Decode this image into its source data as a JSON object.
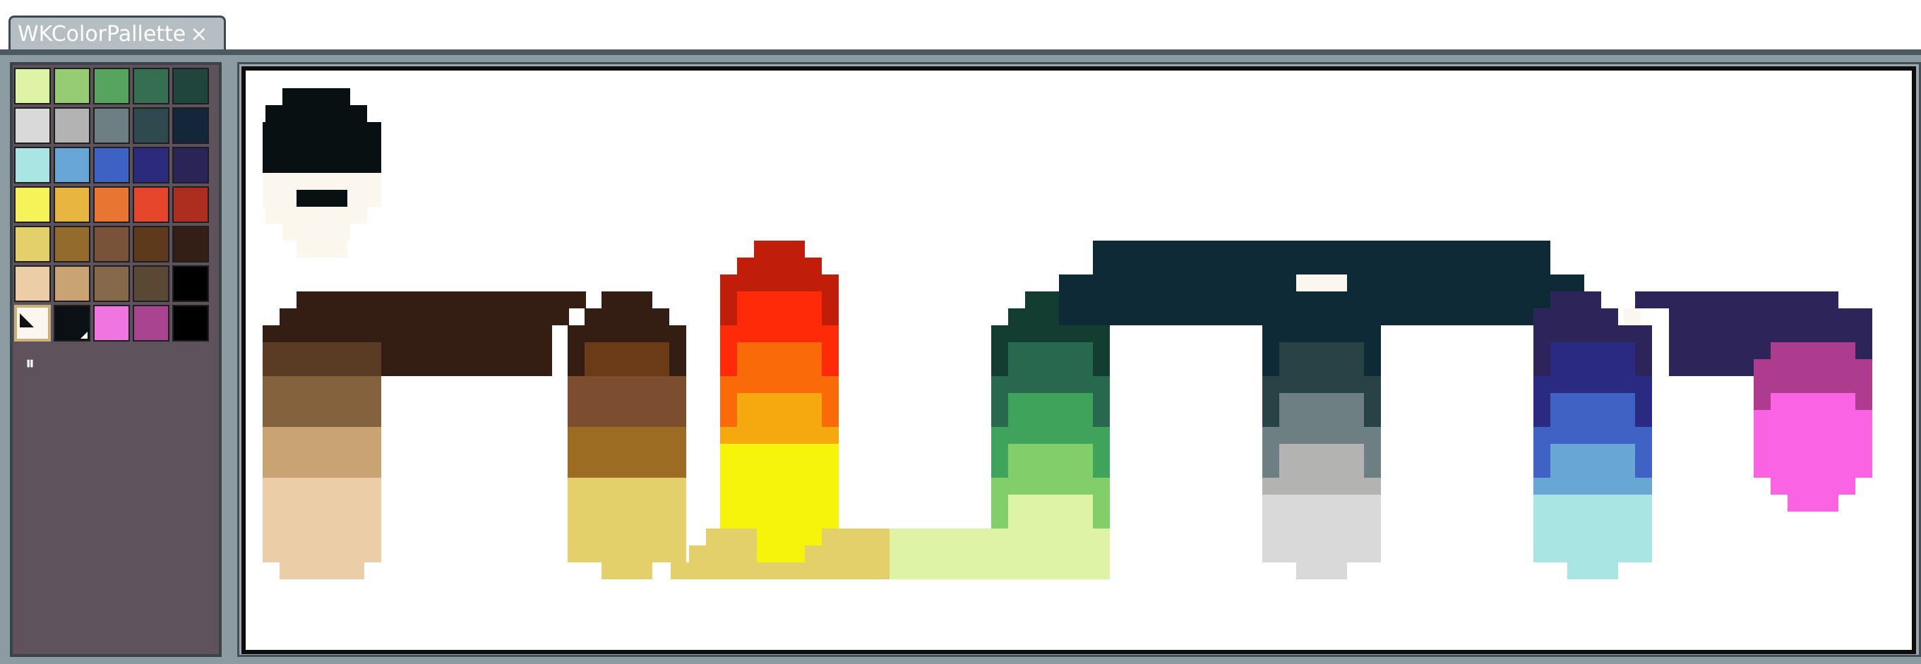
{
  "tab": {
    "title": "WKColorPallette",
    "close_glyph": "×"
  },
  "palette": {
    "columns": 5,
    "selected_index": 30,
    "swatches": [
      "#dff3a6",
      "#94cb73",
      "#56a45e",
      "#356e50",
      "#1f453c",
      "#d8d9d8",
      "#b2b3b2",
      "#6d7f82",
      "#2e4a4e",
      "#14263a",
      "#a9e5e3",
      "#68a6d6",
      "#3e61c4",
      "#2c2a7c",
      "#2b2557",
      "#f6f25a",
      "#e8b640",
      "#e87531",
      "#e5452a",
      "#ad2e1f",
      "#e3d06a",
      "#936b2d",
      "#7a5239",
      "#5e3a1d",
      "#331f15",
      "#ebcda8",
      "#c9a373",
      "#846a4a",
      "#594834",
      "#000000",
      "#fbf7ef",
      "#0a1013",
      "#ef75e1",
      "#a84490",
      "#000000"
    ]
  },
  "pause_glyph": "⏸",
  "art": {
    "colors": {
      "black": "#081012",
      "cream": "#fbf7ef",
      "brown_dark": "#341d12",
      "brown_mid": "#5a3c25",
      "brown_tan": "#84623e",
      "tan": "#c9a373",
      "skin": "#ebcda8",
      "rust_dark": "#6a3b16",
      "rust": "#7d4d2f",
      "ochre": "#9b6c22",
      "sand": "#e3d06a",
      "red_dark": "#c01e0b",
      "red": "#ff2a08",
      "orange": "#fb6a08",
      "amber": "#f6a80f",
      "yellow": "#f6f40a",
      "green_dark": "#123d30",
      "green_mid": "#27684f",
      "green": "#3fa35b",
      "green_light": "#82ce6a",
      "lime": "#dff3a6",
      "navy": "#0f2a37",
      "slate": "#284246",
      "grey_blue": "#6d7f82",
      "grey": "#b3b3b2",
      "grey_light": "#d8d9d8",
      "indigo_dark": "#2d2459",
      "indigo": "#2b2a82",
      "blue": "#3f62c4",
      "sky": "#68a6d6",
      "aqua": "#a9e5e3",
      "magenta": "#ad3c8f",
      "pink": "#fa63e3"
    }
  }
}
